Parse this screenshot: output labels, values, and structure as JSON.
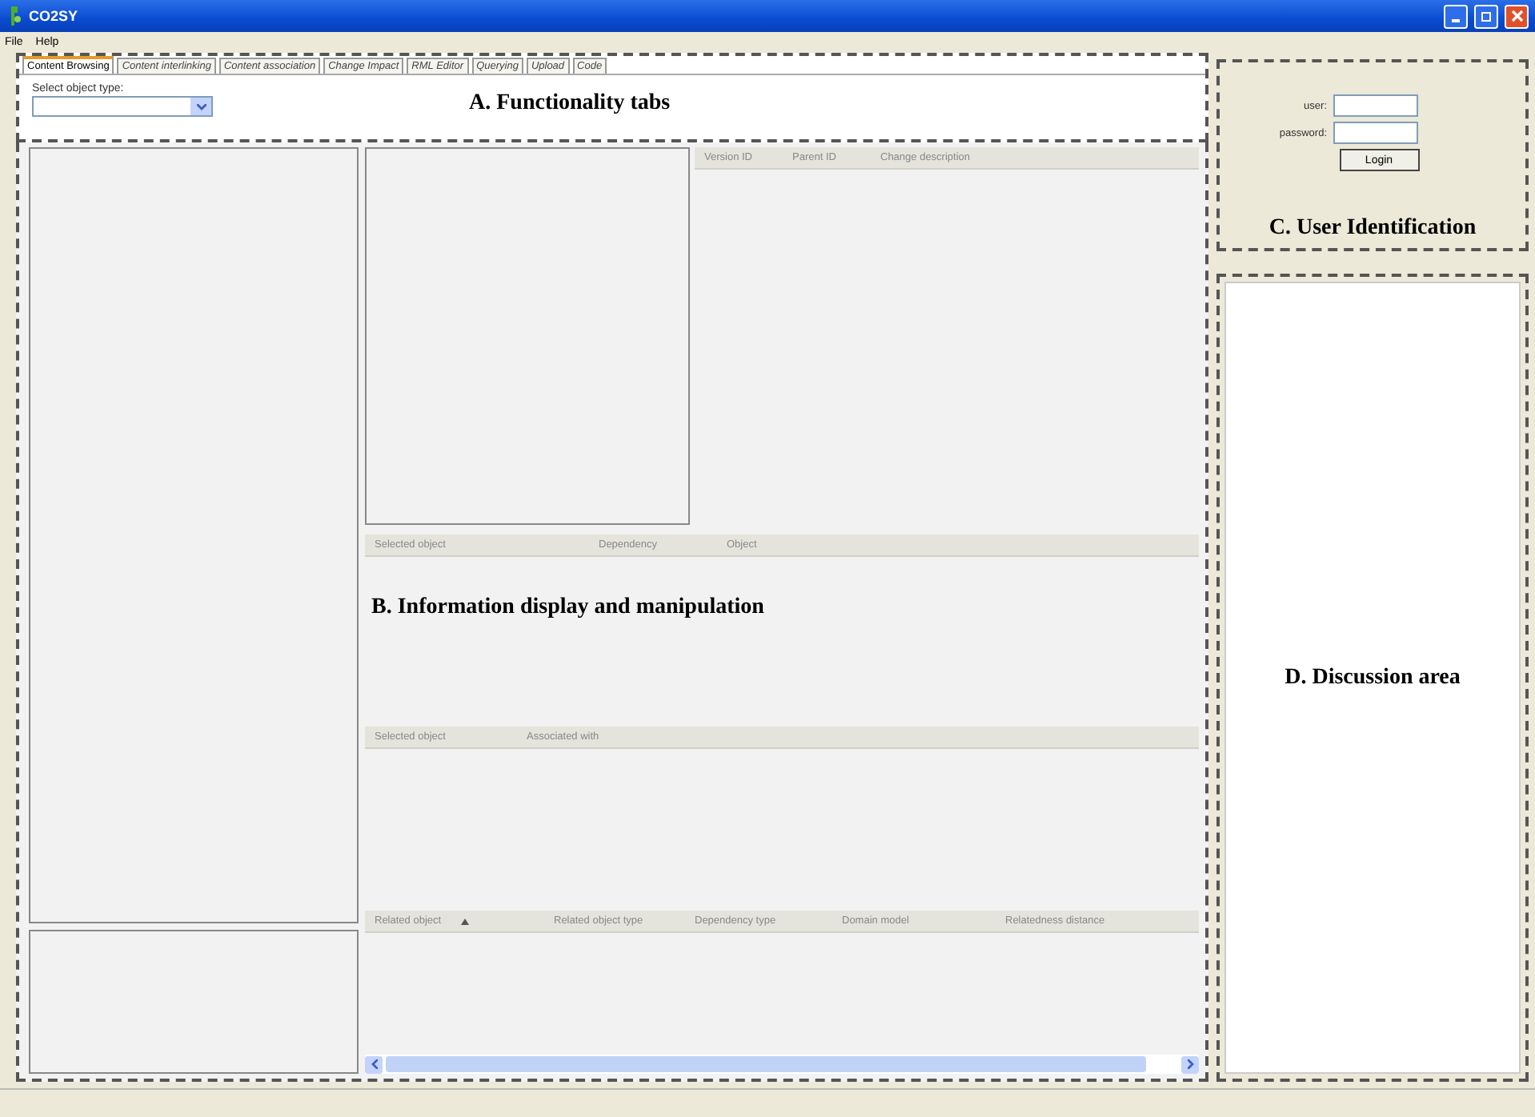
{
  "window": {
    "title": "CO2SY"
  },
  "menu": [
    "File",
    "Help"
  ],
  "tabs": [
    {
      "label": "Content Browsing",
      "selected": true
    },
    {
      "label": "Content interlinking",
      "selected": false
    },
    {
      "label": "Content association",
      "selected": false
    },
    {
      "label": "Change Impact",
      "selected": false
    },
    {
      "label": "RML Editor",
      "selected": false
    },
    {
      "label": "Querying",
      "selected": false
    },
    {
      "label": "Upload",
      "selected": false
    },
    {
      "label": "Code",
      "selected": false
    }
  ],
  "object_type": {
    "label": "Select object type:"
  },
  "regions": {
    "a": "A. Functionality tabs",
    "b": "B. Information display and manipulation",
    "c": "C. User Identification",
    "d": "D. Discussion area"
  },
  "version_table": {
    "columns": [
      "Version ID",
      "Parent ID",
      "Change description"
    ]
  },
  "dependency_table": {
    "columns": [
      "Selected object",
      "Dependency",
      "Object"
    ]
  },
  "association_table": {
    "columns": [
      "Selected object",
      "Associated with"
    ]
  },
  "related_table": {
    "columns": [
      "Related object",
      "Related object type",
      "Dependency type",
      "Domain model",
      "Relatedness distance"
    ]
  },
  "login": {
    "user_label": "user:",
    "password_label": "password:",
    "button": "Login"
  }
}
